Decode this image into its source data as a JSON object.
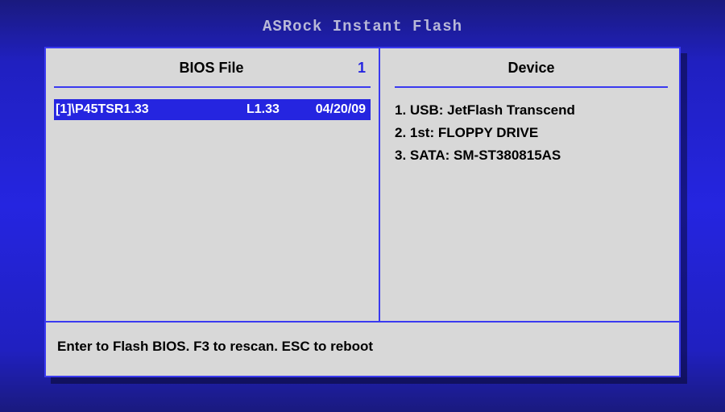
{
  "title": "ASRock Instant Flash",
  "leftPanel": {
    "headerLabel": "BIOS File",
    "count": "1"
  },
  "file": {
    "name": "[1]\\P45TSR1.33",
    "version": "L1.33",
    "date": "04/20/09"
  },
  "rightPanel": {
    "headerLabel": "Device",
    "devices": [
      "1. USB: JetFlash Transcend",
      "2. 1st: FLOPPY DRIVE",
      "3. SATA: SM-ST380815AS"
    ]
  },
  "footer": "Enter to Flash BIOS. F3 to rescan. ESC to reboot"
}
